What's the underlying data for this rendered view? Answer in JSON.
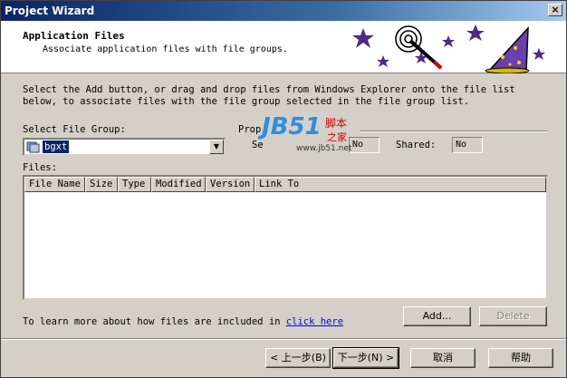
{
  "window": {
    "title": "Project Wizard",
    "close_glyph": "×"
  },
  "header": {
    "title": "Application Files",
    "subtitle": "Associate application files with file groups."
  },
  "intro": "Select the Add button, or drag and drop files from Windows Explorer onto the file list below, to associate files with the file group selected in the file group list.",
  "file_group": {
    "label": "Select File Group:",
    "value": "bgxt"
  },
  "properties": {
    "group_label": "Prop",
    "self_label": "Se",
    "self_value": "No",
    "shared_label": "Shared:",
    "shared_value": "No"
  },
  "files": {
    "label": "Files:",
    "columns": [
      "File Name",
      "Size",
      "Type",
      "Modified",
      "Version",
      "Link To"
    ]
  },
  "help": {
    "text": "To learn more about how files are included in ",
    "link": "click here"
  },
  "buttons": {
    "add": "Add...",
    "delete": "Delete"
  },
  "footer": {
    "back": "< 上一步(B)",
    "next": "下一步(N) >",
    "cancel": "取消",
    "help": "帮助"
  },
  "watermark": {
    "brand": "JB51",
    "cn": "脚本",
    "cn2": "之家",
    "url": "www.jb51.net"
  },
  "colors": {
    "titlebar": "#0a246a",
    "face": "#d4d0c8",
    "link": "#0000ff",
    "selection": "#0a246a",
    "star": "#4b2a8c"
  }
}
